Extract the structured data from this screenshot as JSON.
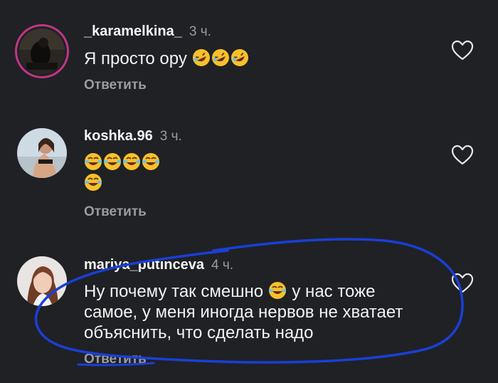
{
  "comments": [
    {
      "username": "_karamelkina_",
      "time": "3 ч.",
      "text": "Я просто ору",
      "emojis": [
        "rofl",
        "rofl",
        "rofl"
      ],
      "reply_label": "Ответить"
    },
    {
      "username": "koshka.96",
      "time": "3 ч.",
      "emojis_line1": [
        "joy",
        "joy",
        "joy",
        "joy"
      ],
      "emojis_line2": [
        "joy"
      ],
      "reply_label": "Ответить"
    },
    {
      "username": "mariya_putinceva",
      "time": "4 ч.",
      "text_part1": "Ну почему так смешно",
      "text_part2": "у нас тоже самое, у меня иногда нервов не хватает объяснить, что сделать надо",
      "emojis": [
        "joy"
      ],
      "reply_label": "Ответить"
    }
  ],
  "colors": {
    "background": "#1f2125",
    "secondary_text": "#9a9ca2",
    "annotation": "#1a3fd6"
  },
  "icons": [
    "heart-outline-icon"
  ]
}
